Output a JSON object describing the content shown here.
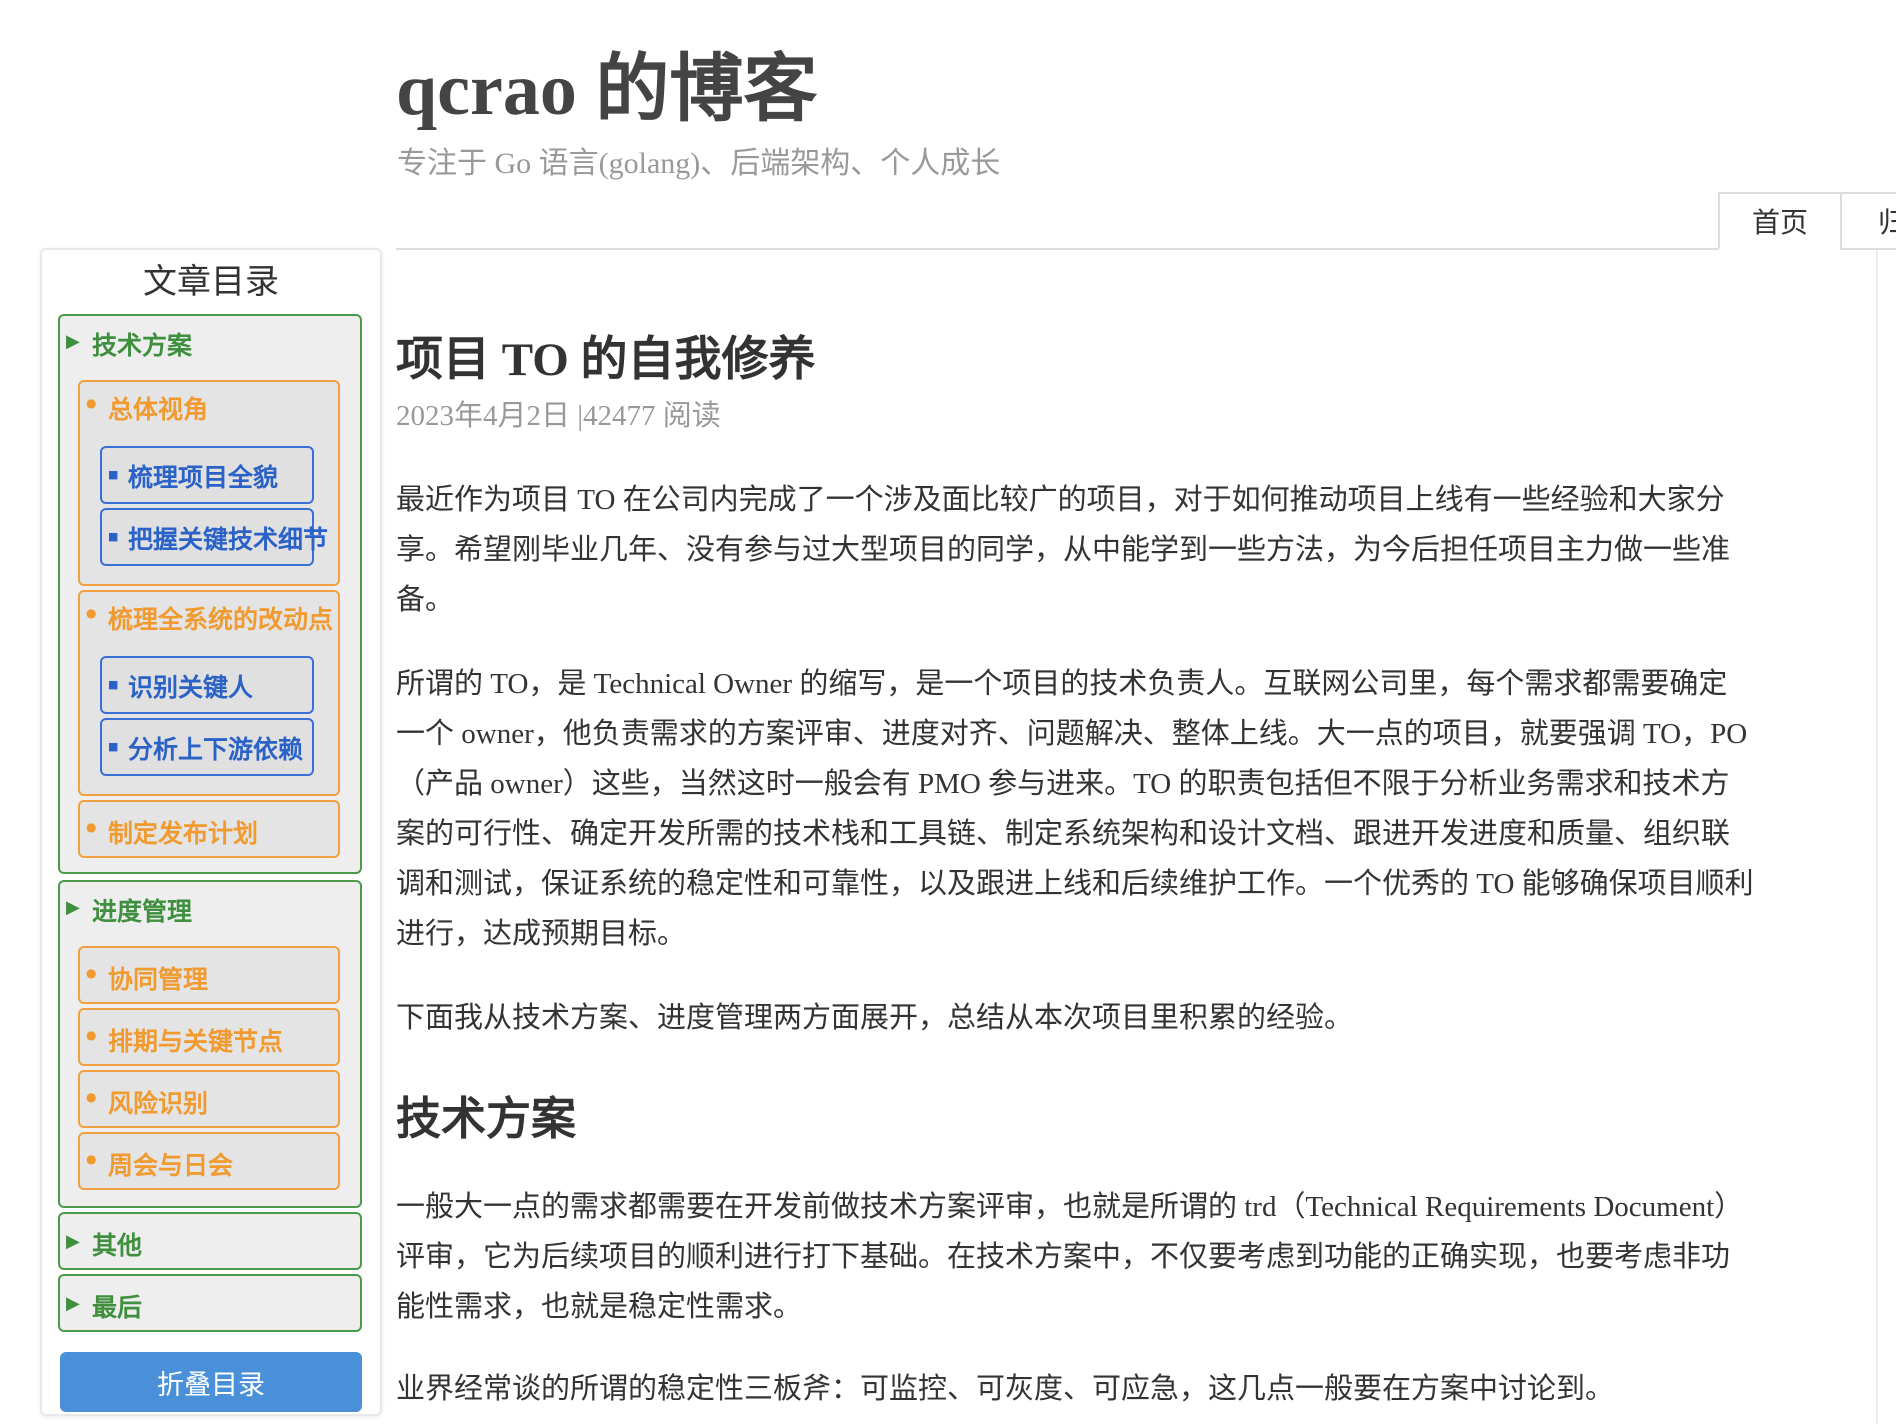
{
  "site": {
    "title": "qcrao 的博客",
    "subtitle": "专注于 Go 语言(golang)、后端架构、个人成长"
  },
  "nav": {
    "tabs": [
      {
        "label": "首页"
      },
      {
        "label": "归"
      }
    ]
  },
  "toc": {
    "title": "文章目录",
    "collapse_label": "折叠目录",
    "marker_tri": "▶",
    "marker_dot": "●",
    "marker_sq": "■",
    "items": {
      "tech": "技术方案",
      "overall": "总体视角",
      "sort_project": "梳理项目全貌",
      "key_detail": "把握关键技术细节",
      "sort_changes": "梳理全系统的改动点",
      "key_people": "识别关键人",
      "deps": "分析上下游依赖",
      "release": "制定发布计划",
      "progress": "进度管理",
      "coop": "协同管理",
      "schedule": "排期与关键节点",
      "risk": "风险识别",
      "meeting": "周会与日会",
      "other": "其他",
      "last": "最后"
    }
  },
  "post": {
    "title": "项目 TO 的自我修养",
    "meta": "2023年4月2日 |42477 阅读",
    "p1": "最近作为项目 TO 在公司内完成了一个涉及面比较广的项目，对于如何推动项目上线有一些经验和大家分享。希望刚毕业几年、没有参与过大型项目的同学，从中能学到一些方法，为今后担任项目主力做一些准备。",
    "p2": "所谓的 TO，是 Technical Owner 的缩写，是一个项目的技术负责人。互联网公司里，每个需求都需要确定一个 owner，他负责需求的方案评审、进度对齐、问题解决、整体上线。大一点的项目，就要强调 TO，PO（产品 owner）这些，当然这时一般会有 PMO 参与进来。TO 的职责包括但不限于分析业务需求和技术方案的可行性、确定开发所需的技术栈和工具链、制定系统架构和设计文档、跟进开发进度和质量、组织联调和测试，保证系统的稳定性和可靠性，以及跟进上线和后续维护工作。一个优秀的 TO 能够确保项目顺利进行，达成预期目标。",
    "p3": "下面我从技术方案、进度管理两方面展开，总结从本次项目里积累的经验。",
    "h2": "技术方案",
    "p4": "一般大一点的需求都需要在开发前做技术方案评审，也就是所谓的 trd（Technical Requirements Document）评审，它为后续项目的顺利进行打下基础。在技术方案中，不仅要考虑到功能的正确实现，也要考虑非功能性需求，也就是稳定性需求。",
    "p5": "业界经常谈的所谓的稳定性三板斧：可监控、可灰度、可应急，这几点一般要在方案中讨论到。"
  }
}
